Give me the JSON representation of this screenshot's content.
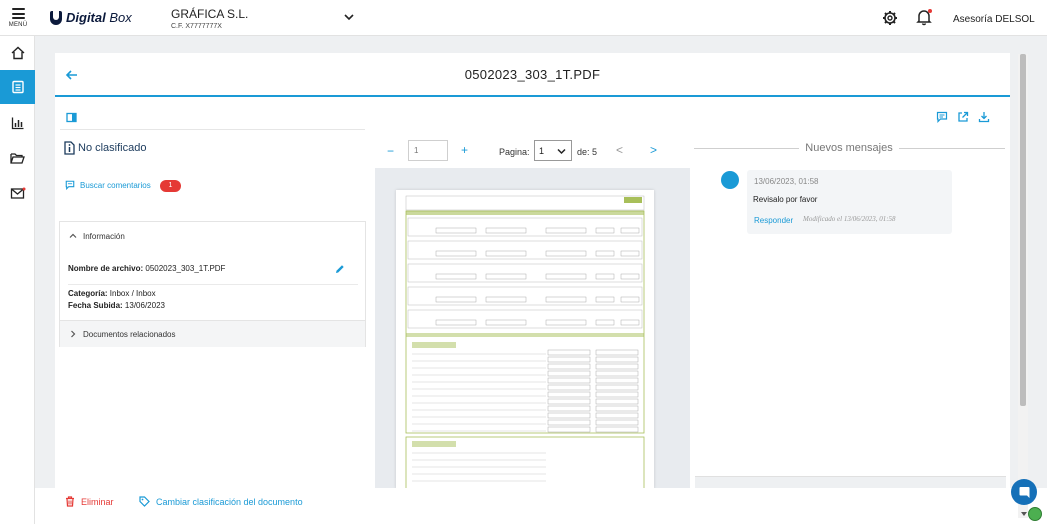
{
  "app": {
    "menu_label": "MENÚ",
    "logo_brand": "Digital",
    "logo_product": "Box",
    "company_name": "GRÁFICA S.L.",
    "company_cif": "C.F. X7777777X",
    "user_name": "Asesoría DELSOL"
  },
  "document": {
    "title": "0502023_303_1T.PDF",
    "classification": "No clasificado",
    "search_comments_label": "Buscar comentarios",
    "comments_count": "1"
  },
  "info": {
    "section_label": "Información",
    "filename_label": "Nombre de archivo:",
    "filename_value": "0502023_303_1T.PDF",
    "category_label": "Categoría:",
    "category_value": "Inbox / Inbox",
    "date_label": "Fecha Subida:",
    "date_value": "13/06/2023",
    "related_label": "Documentos relacionados"
  },
  "pager": {
    "minus": "−",
    "plus": "+",
    "zoom_placeholder": "1",
    "page_label": "Pagina:",
    "page_value": "1",
    "total_label": "de: 5",
    "prev": "<",
    "next": ">"
  },
  "messages": {
    "title": "Nuevos mensajes",
    "items": [
      {
        "date": "13/06/2023, 01:58",
        "text": "Revisalo por favor",
        "reply_label": "Responder",
        "modified": "Modificado el 13/06/2023, 01:58"
      }
    ]
  },
  "actions": {
    "delete_label": "Eliminar",
    "change_class_label": "Cambiar clasificación del documento"
  },
  "colors": {
    "accent": "#1a9ad6",
    "danger": "#e53935",
    "brand_dark": "#0c1a3c",
    "form_green": "#a8bf5a"
  }
}
